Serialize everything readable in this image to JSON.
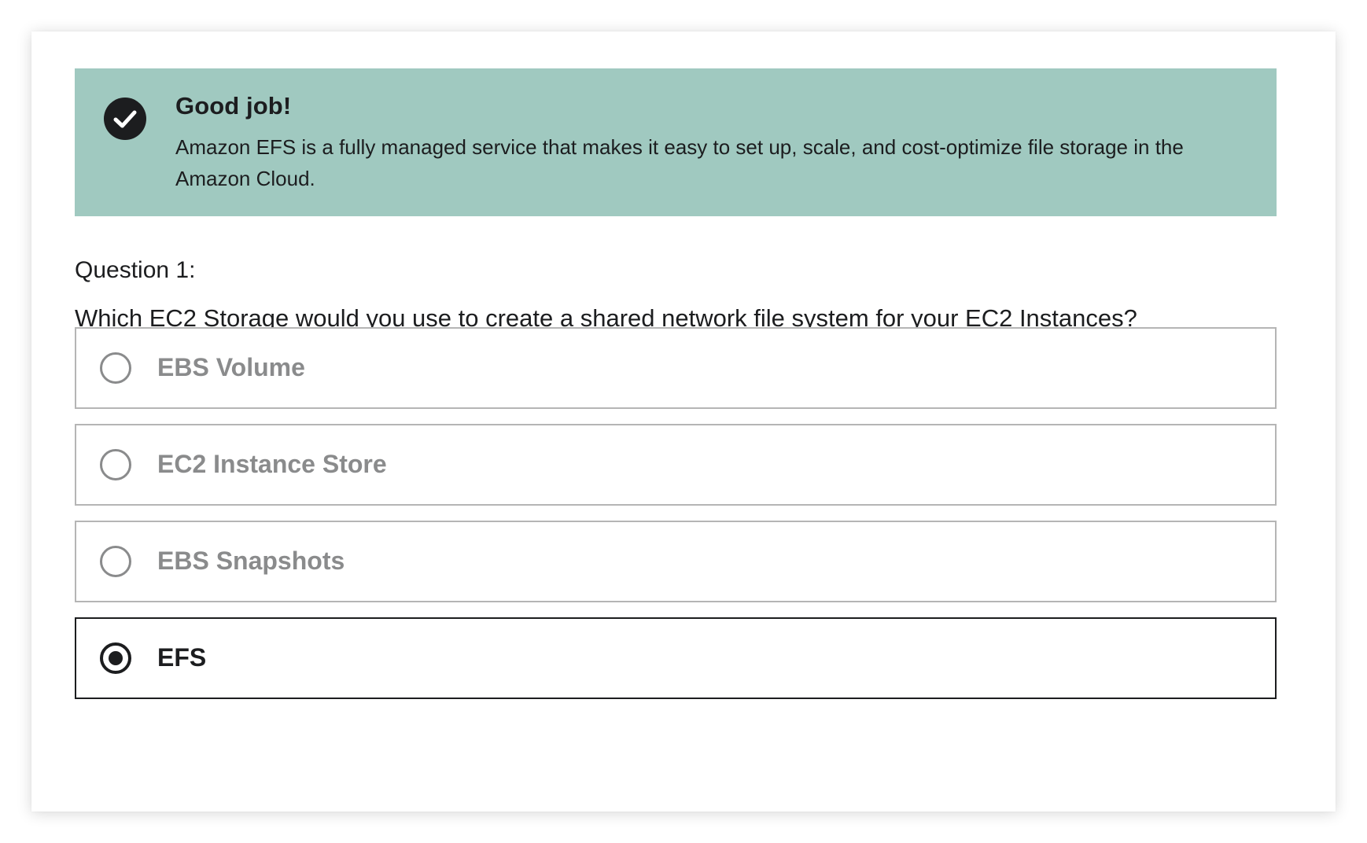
{
  "alert": {
    "icon": "check-circle-icon",
    "background_color": "#a0c9c0",
    "title": "Good job!",
    "body": "Amazon EFS is a fully managed service that makes it easy to set up, scale, and cost-optimize file storage in the Amazon Cloud."
  },
  "question": {
    "number_label": "Question 1:",
    "text": "Which EC2 Storage would you use to create a shared network file system for your EC2 Instances?",
    "options": [
      {
        "label": "EBS Volume",
        "selected": false
      },
      {
        "label": "EC2 Instance Store",
        "selected": false
      },
      {
        "label": "EBS Snapshots",
        "selected": false
      },
      {
        "label": "EFS",
        "selected": true
      }
    ]
  }
}
